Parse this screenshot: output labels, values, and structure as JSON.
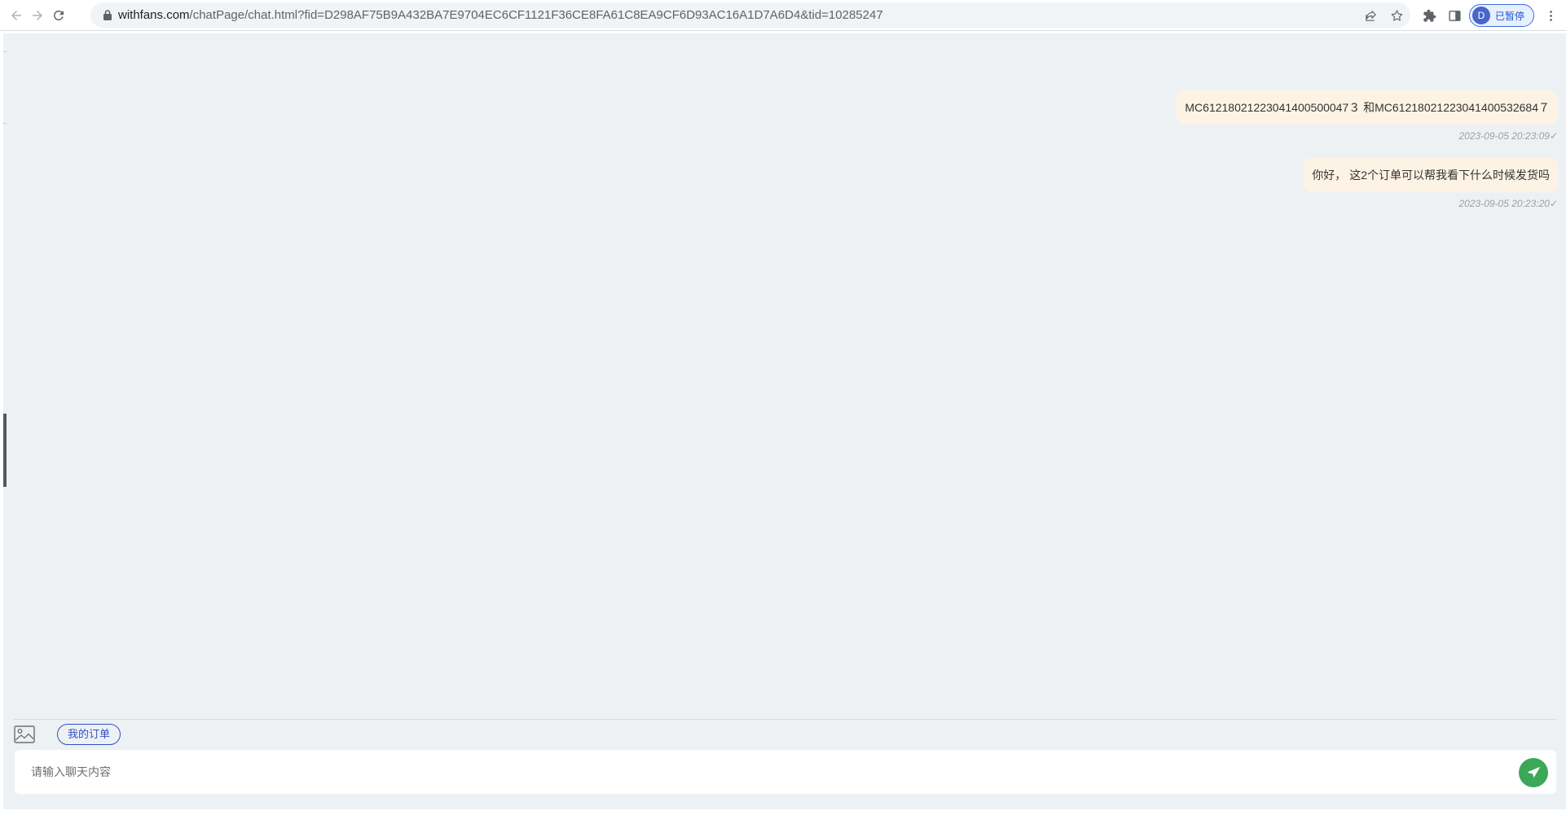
{
  "browser": {
    "url_host": "withfans.com",
    "url_rest": "/chatPage/chat.html?fid=D298AF75B9A432BA7E9704EC6CF1121F36CE8FA61C8EA9CF6D93AC16A1D7A6D4&tid=10285247",
    "profile_initial": "D",
    "profile_label": "已暂停",
    "icons": {
      "back": "arrow-left-icon",
      "forward": "arrow-right-icon",
      "reload": "reload-icon",
      "lock": "lock-icon",
      "share": "share-icon",
      "bookmark": "star-icon",
      "extensions": "puzzle-icon",
      "side_panel": "side-panel-icon",
      "menu": "kebab-menu-icon"
    }
  },
  "chat": {
    "messages": [
      {
        "text": "MC61218021223041400500047３ 和MC61218021223041400532684７",
        "time": "2023-09-05 20:23:09",
        "status": "✓"
      },
      {
        "text": "你好， 这2个订单可以帮我看下什么时候发货吗",
        "time": "2023-09-05 20:23:20",
        "status": "✓"
      }
    ]
  },
  "composer": {
    "image_icon": "image-icon",
    "quick_action_label": "我的订单",
    "input_value": "",
    "input_placeholder": "请输入聊天内容",
    "send_icon": "paper-plane-icon"
  },
  "colors": {
    "page_background": "#eef1f4",
    "bubble_background": "#fdf3e4",
    "accent_blue": "#3150c8",
    "send_green": "#3aa858"
  }
}
